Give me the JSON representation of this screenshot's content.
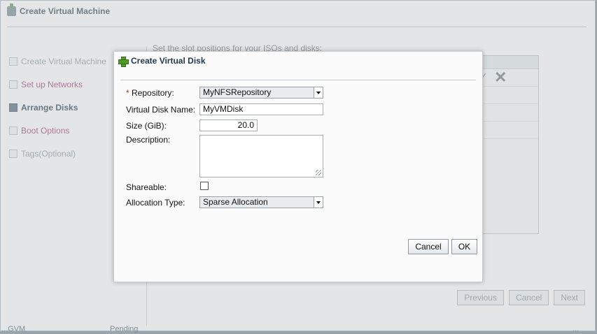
{
  "background": {
    "window_title": "Create Virtual Machine",
    "steps": [
      {
        "label": "Create Virtual Machine",
        "state": "done"
      },
      {
        "label": "Set up Networks",
        "state": "done"
      },
      {
        "label": "Arrange Disks",
        "state": "active"
      },
      {
        "label": "Boot Options",
        "state": "pending"
      },
      {
        "label": "Tags(Optional)",
        "state": "pending"
      }
    ],
    "instruction": "Set the slot positions for your ISOs and disks:",
    "buttons": {
      "previous": "Previous",
      "cancel": "Cancel",
      "next": "Next"
    },
    "bottom_left": "...GVM",
    "bottom_mid": "Pending",
    "bottom_right": "..."
  },
  "dialog": {
    "title": "Create Virtual Disk",
    "fields": {
      "repository_required_marker": "*",
      "repository_label": "Repository:",
      "repository_value": "MyNFSRepository",
      "disk_name_label": "Virtual Disk Name:",
      "disk_name_value": "MyVMDisk",
      "size_label": "Size (GiB):",
      "size_value": "20.0",
      "description_label": "Description:",
      "description_value": "",
      "shareable_label": "Shareable:",
      "shareable_checked": false,
      "allocation_label": "Allocation Type:",
      "allocation_value": "Sparse Allocation"
    },
    "buttons": {
      "cancel": "Cancel",
      "ok": "OK"
    }
  },
  "colors": {
    "accent_title": "#22394d",
    "plus_icon": "#4e9a28",
    "step_done": "#b56e99"
  }
}
